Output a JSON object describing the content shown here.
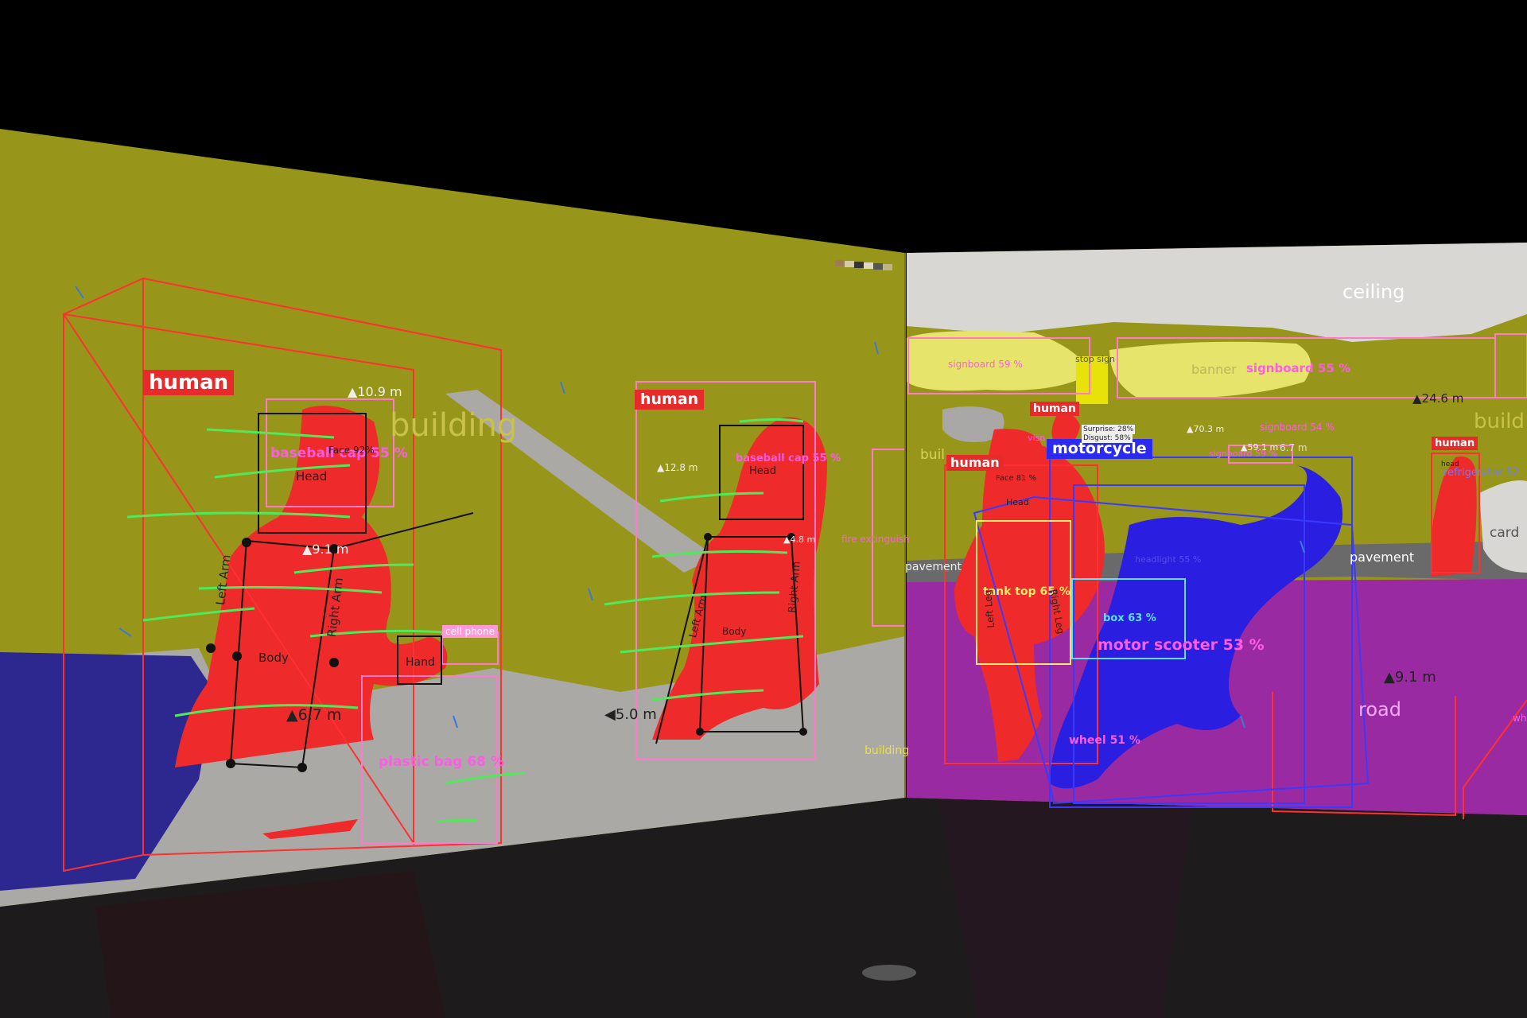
{
  "scene": {
    "colors": {
      "background": "#000000",
      "floor": "#1d1b1c",
      "building": "#98961a",
      "ceiling": "#d9d7d4",
      "road": "#9a2aa2",
      "human": "#ef2a2a",
      "vehicle": "#2a1ee0",
      "wall_blue": "#2d2790",
      "sidewalk": "#a9a8a6",
      "signboard": "#e6e46a",
      "flow_arrow": "#52e85a",
      "box_pink": "#ff7acb",
      "box_red": "#ff3030",
      "box_blue": "#3a3aff"
    },
    "left_wall": {
      "human_tags": [
        "human",
        "human"
      ],
      "semantic_labels": [
        "building",
        "building"
      ],
      "detections": [
        "baseball cap 55 %",
        "baseball cap 55 %",
        "plastic bag 68 %",
        "cell phone",
        "fire extinguish"
      ],
      "face_labels": [
        "Face 92%"
      ],
      "joints_person1": {
        "head": "Head",
        "left_arm": "Left Arm",
        "right_arm": "Right Arm",
        "body": "Body",
        "hand": "Hand"
      },
      "joints_person2": {
        "head": "Head",
        "left_arm": "Left Arm",
        "right_arm": "Right Arm",
        "body": "Body"
      },
      "distances": [
        "10.9 m",
        "9.1 m",
        "6.7 m",
        "12.8 m",
        "4.8 m",
        "5.0 m"
      ]
    },
    "right_wall": {
      "semantic_labels": [
        "ceiling",
        "banner",
        "buil",
        "pavement",
        "pavement",
        "road",
        "build",
        "card"
      ],
      "human_tags": [
        "human",
        "human",
        "human"
      ],
      "vehicle_tag": "motorcycle",
      "detections": [
        "signboard 59 %",
        "signboard 55 %",
        "signboard 54 %",
        "signboard 59 %",
        "stop sign",
        "tank top 65 %",
        "box 63 %",
        "motor scooter 53 %",
        "wheel 51 %",
        "headlight 55 %",
        "refrigerator 52",
        "viso",
        "Face 81 %",
        "Head"
      ],
      "emotions": [
        "Surprise: 28%",
        "Disgust: 58%"
      ],
      "joints_person3": {
        "left_leg": "Left Leg",
        "right_leg": "Right Leg"
      },
      "distances": [
        "24.6 m",
        "70.3 m",
        "59.1 m",
        "6.7 m",
        "9.1 m"
      ],
      "misc": [
        "head",
        "wh"
      ]
    }
  }
}
